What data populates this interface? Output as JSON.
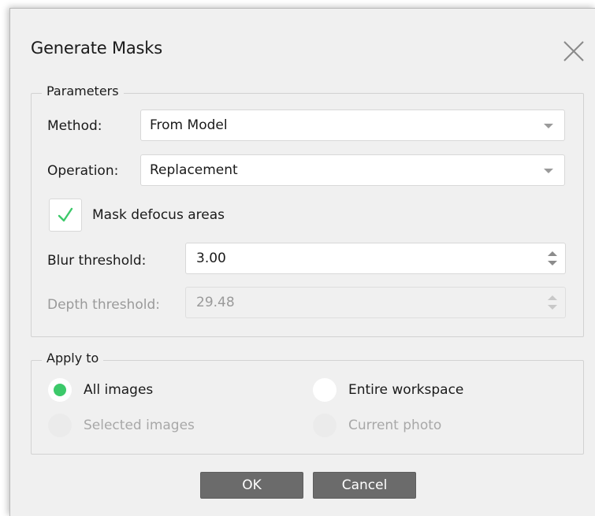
{
  "dialog": {
    "title": "Generate Masks",
    "close_icon": "close-icon"
  },
  "parameters": {
    "group_label": "Parameters",
    "method": {
      "label": "Method:",
      "value": "From Model"
    },
    "operation": {
      "label": "Operation:",
      "value": "Replacement"
    },
    "mask_defocus": {
      "label": "Mask defocus areas",
      "checked": true
    },
    "blur_threshold": {
      "label": "Blur threshold:",
      "value": "3.00",
      "enabled": true
    },
    "depth_threshold": {
      "label": "Depth threshold:",
      "value": "29.48",
      "enabled": false
    }
  },
  "apply_to": {
    "group_label": "Apply to",
    "options": [
      {
        "label": "All images",
        "selected": true,
        "enabled": true
      },
      {
        "label": "Entire workspace",
        "selected": false,
        "enabled": true
      },
      {
        "label": "Selected images",
        "selected": false,
        "enabled": false
      },
      {
        "label": "Current photo",
        "selected": false,
        "enabled": false
      }
    ]
  },
  "buttons": {
    "ok_label": "OK",
    "cancel_label": "Cancel"
  },
  "colors": {
    "accent": "#3cc96a",
    "button_bg": "#6b6b6b",
    "dialog_bg": "#f0f0f0",
    "disabled_text": "#9a9a9a"
  }
}
